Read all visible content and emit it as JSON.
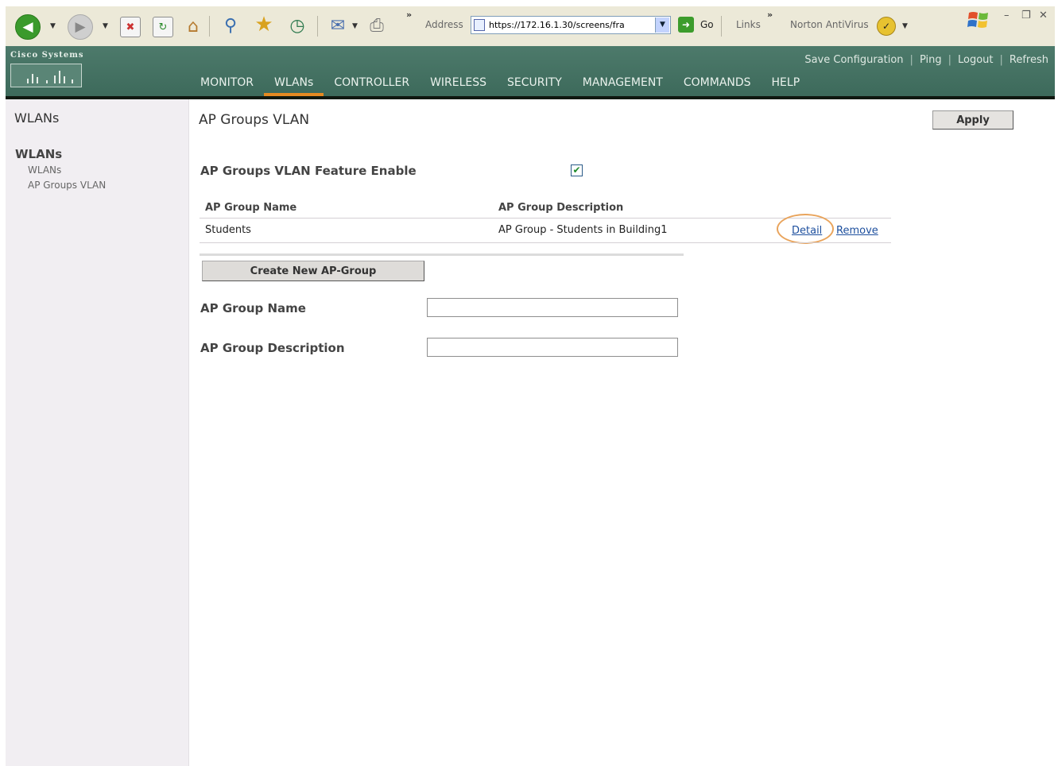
{
  "browser": {
    "chevron_1": "»",
    "chevron_2": "»",
    "address_label": "Address",
    "address_url": "https://172.16.1.30/screens/fra",
    "go_label": "Go",
    "links_label": "Links",
    "norton_label": "Norton AntiVirus"
  },
  "header": {
    "brand": "Cisco Systems",
    "top_links": [
      "Save Configuration",
      "Ping",
      "Logout",
      "Refresh"
    ],
    "nav": [
      "MONITOR",
      "WLANs",
      "CONTROLLER",
      "WIRELESS",
      "SECURITY",
      "MANAGEMENT",
      "COMMANDS",
      "HELP"
    ],
    "active_nav": "WLANs"
  },
  "sidebar": {
    "title": "WLANs",
    "section": "WLANs",
    "items": [
      "WLANs",
      "AP Groups VLAN"
    ]
  },
  "main": {
    "title": "AP Groups VLAN",
    "apply_label": "Apply",
    "feature_label": "AP Groups VLAN Feature Enable",
    "feature_enabled": true,
    "table": {
      "headers": [
        "AP Group Name",
        "AP Group Description"
      ],
      "rows": [
        {
          "name": "Students",
          "description": "AP Group - Students in Building1",
          "detail_label": "Detail",
          "remove_label": "Remove"
        }
      ]
    },
    "create_button_label": "Create New AP-Group",
    "form": {
      "group_name_label": "AP Group Name",
      "group_name_value": "",
      "group_description_label": "AP Group Description",
      "group_description_value": ""
    }
  },
  "colors": {
    "header_bg": "#4d7a6b",
    "active_tab": "#e58a22",
    "link": "#1d4f9e",
    "highlight": "#e9a45c",
    "sidebar_bg": "#f1eef2"
  }
}
